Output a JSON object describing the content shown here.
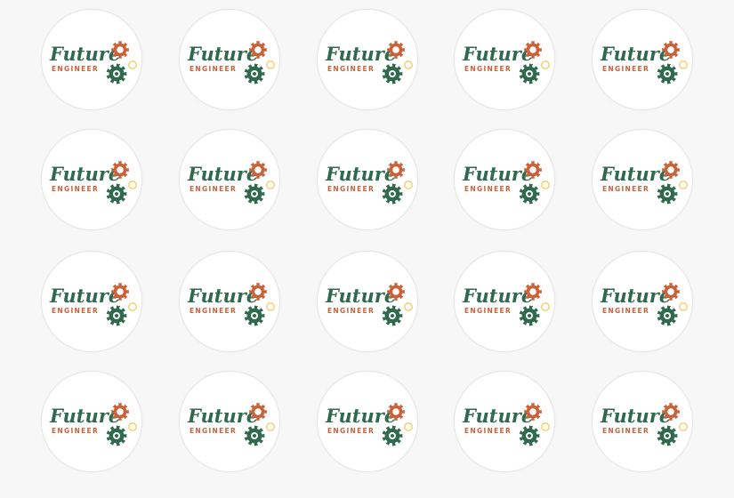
{
  "sheet": {
    "rows": 4,
    "columns": 5,
    "background": "#f7f7f7"
  },
  "logo": {
    "title": "Future",
    "subtitle": "ENGINEER",
    "colors": {
      "title": "#2f6a4d",
      "subtitle": "#c8623a",
      "orange_gear": "#c8623a",
      "green_gear": "#2f6a4d",
      "yellow_gear": "#f2d27a",
      "sticker_fill": "#ffffff",
      "sticker_border": "#e6e6e6"
    },
    "icons": [
      "orange-gear-icon",
      "green-gear-icon",
      "yellow-gear-icon"
    ]
  }
}
